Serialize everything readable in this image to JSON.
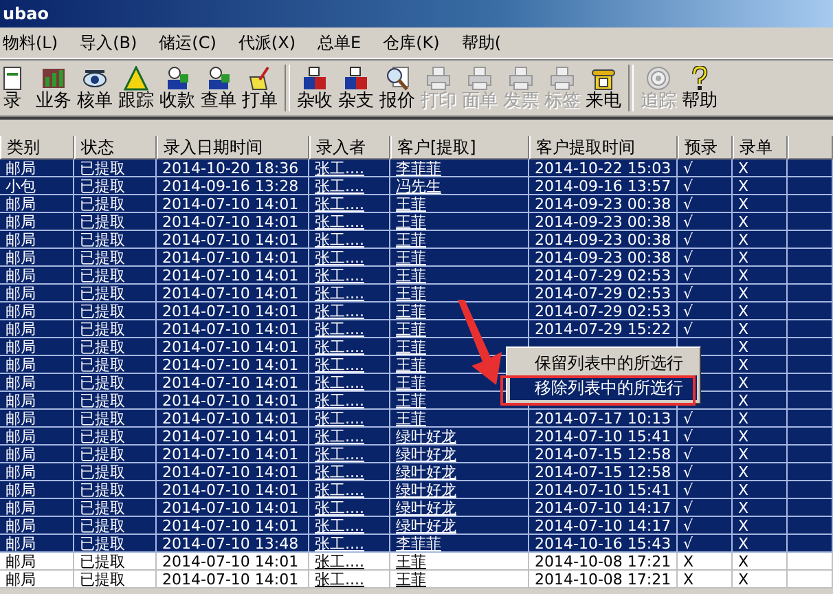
{
  "window": {
    "title": "ubao"
  },
  "menu": [
    "物料(L)",
    "导入(B)",
    "储运(C)",
    "代派(X)",
    "总单E",
    "仓库(K)",
    "帮助("
  ],
  "toolbar": [
    [
      {
        "label": "录",
        "disabled": false
      },
      {
        "label": "业务",
        "disabled": false
      },
      {
        "label": "核单",
        "disabled": false
      },
      {
        "label": "跟踪",
        "disabled": false
      },
      {
        "label": "收款",
        "disabled": false
      },
      {
        "label": "查单",
        "disabled": false
      },
      {
        "label": "打单",
        "disabled": false
      }
    ],
    [
      {
        "label": "杂收",
        "disabled": false
      },
      {
        "label": "杂支",
        "disabled": false
      },
      {
        "label": "报价",
        "disabled": false
      },
      {
        "label": "打印",
        "disabled": true
      },
      {
        "label": "面单",
        "disabled": true
      },
      {
        "label": "发票",
        "disabled": true
      },
      {
        "label": "标签",
        "disabled": true
      },
      {
        "label": "来电",
        "disabled": false
      }
    ],
    [
      {
        "label": "追踪",
        "disabled": true
      },
      {
        "label": "帮助",
        "disabled": false
      }
    ]
  ],
  "table": {
    "columns": [
      "类别",
      "状态",
      "录入日期时间",
      "录入者",
      "客户[提取]",
      "客户提取时间",
      "预录",
      "录单"
    ],
    "rows": [
      {
        "type": "邮局",
        "status": "已提取",
        "entered": "2014-10-20 18:36",
        "by": "张工....",
        "customer": "李菲菲",
        "picked": "2014-10-22 15:03",
        "pre": "√",
        "order": "X",
        "selected": true
      },
      {
        "type": "小包",
        "status": "已提取",
        "entered": "2014-09-16 13:28",
        "by": "张工....",
        "customer": "冯先生",
        "picked": "2014-09-16 13:57",
        "pre": "√",
        "order": "X",
        "selected": true
      },
      {
        "type": "邮局",
        "status": "已提取",
        "entered": "2014-07-10 14:01",
        "by": "张工....",
        "customer": "王菲",
        "picked": "2014-09-23 00:38",
        "pre": "√",
        "order": "X",
        "selected": true
      },
      {
        "type": "邮局",
        "status": "已提取",
        "entered": "2014-07-10 14:01",
        "by": "张工....",
        "customer": "王菲",
        "picked": "2014-09-23 00:38",
        "pre": "√",
        "order": "X",
        "selected": true
      },
      {
        "type": "邮局",
        "status": "已提取",
        "entered": "2014-07-10 14:01",
        "by": "张工....",
        "customer": "王菲",
        "picked": "2014-09-23 00:38",
        "pre": "√",
        "order": "X",
        "selected": true
      },
      {
        "type": "邮局",
        "status": "已提取",
        "entered": "2014-07-10 14:01",
        "by": "张工....",
        "customer": "王菲",
        "picked": "2014-09-23 00:38",
        "pre": "√",
        "order": "X",
        "selected": true
      },
      {
        "type": "邮局",
        "status": "已提取",
        "entered": "2014-07-10 14:01",
        "by": "张工....",
        "customer": "王菲",
        "picked": "2014-07-29 02:53",
        "pre": "√",
        "order": "X",
        "selected": true
      },
      {
        "type": "邮局",
        "status": "已提取",
        "entered": "2014-07-10 14:01",
        "by": "张工....",
        "customer": "王菲",
        "picked": "2014-07-29 02:53",
        "pre": "√",
        "order": "X",
        "selected": true
      },
      {
        "type": "邮局",
        "status": "已提取",
        "entered": "2014-07-10 14:01",
        "by": "张工....",
        "customer": "王菲",
        "picked": "2014-07-29 02:53",
        "pre": "√",
        "order": "X",
        "selected": true
      },
      {
        "type": "邮局",
        "status": "已提取",
        "entered": "2014-07-10 14:01",
        "by": "张工....",
        "customer": "王菲",
        "picked": "2014-07-29 15:22",
        "pre": "√",
        "order": "X",
        "selected": true
      },
      {
        "type": "邮局",
        "status": "已提取",
        "entered": "2014-07-10 14:01",
        "by": "张工....",
        "customer": "王菲",
        "order": "X",
        "selected": true
      },
      {
        "type": "邮局",
        "status": "已提取",
        "entered": "2014-07-10 14:01",
        "by": "张工....",
        "customer": "王菲",
        "order": "X",
        "selected": true
      },
      {
        "type": "邮局",
        "status": "已提取",
        "entered": "2014-07-10 14:01",
        "by": "张工....",
        "customer": "王菲",
        "order": "X",
        "selected": true
      },
      {
        "type": "邮局",
        "status": "已提取",
        "entered": "2014-07-10 14:01",
        "by": "张工....",
        "customer": "王菲",
        "order": "X",
        "selected": true
      },
      {
        "type": "邮局",
        "status": "已提取",
        "entered": "2014-07-10 14:01",
        "by": "张工....",
        "customer": "王菲",
        "picked": "2014-07-17 10:13",
        "pre": "√",
        "order": "X",
        "selected": true
      },
      {
        "type": "邮局",
        "status": "已提取",
        "entered": "2014-07-10 14:01",
        "by": "张工....",
        "customer": "绿叶好龙",
        "picked": "2014-07-10 15:41",
        "pre": "√",
        "order": "X",
        "selected": true
      },
      {
        "type": "邮局",
        "status": "已提取",
        "entered": "2014-07-10 14:01",
        "by": "张工....",
        "customer": "绿叶好龙",
        "picked": "2014-07-15 12:58",
        "pre": "√",
        "order": "X",
        "selected": true
      },
      {
        "type": "邮局",
        "status": "已提取",
        "entered": "2014-07-10 14:01",
        "by": "张工....",
        "customer": "绿叶好龙",
        "picked": "2014-07-15 12:58",
        "pre": "√",
        "order": "X",
        "selected": true
      },
      {
        "type": "邮局",
        "status": "已提取",
        "entered": "2014-07-10 14:01",
        "by": "张工....",
        "customer": "绿叶好龙",
        "picked": "2014-07-10 15:41",
        "pre": "√",
        "order": "X",
        "selected": true
      },
      {
        "type": "邮局",
        "status": "已提取",
        "entered": "2014-07-10 14:01",
        "by": "张工....",
        "customer": "绿叶好龙",
        "picked": "2014-07-10 14:17",
        "pre": "√",
        "order": "X",
        "selected": true
      },
      {
        "type": "邮局",
        "status": "已提取",
        "entered": "2014-07-10 14:01",
        "by": "张工....",
        "customer": "绿叶好龙",
        "picked": "2014-07-10 14:17",
        "pre": "√",
        "order": "X",
        "selected": true
      },
      {
        "type": "邮局",
        "status": "已提取",
        "entered": "2014-07-10 13:48",
        "by": "张工....",
        "customer": "李菲菲",
        "picked": "2014-10-16 15:43",
        "pre": "√",
        "order": "X",
        "selected": true
      },
      {
        "type": "邮局",
        "status": "已提取",
        "entered": "2014-07-10 14:01",
        "by": "张工....",
        "customer": "王菲",
        "picked": "2014-10-08 17:21",
        "pre": "X",
        "order": "X",
        "selected": false
      },
      {
        "type": "邮局",
        "status": "已提取",
        "entered": "2014-07-10 14:01",
        "by": "张工....",
        "customer": "王菲",
        "picked": "2014-10-08 17:21",
        "pre": "X",
        "order": "X",
        "selected": false
      }
    ]
  },
  "context_menu": [
    {
      "label": "保留列表中的所选行",
      "selected": false
    },
    {
      "label": "移除列表中的所选行",
      "selected": true
    }
  ]
}
